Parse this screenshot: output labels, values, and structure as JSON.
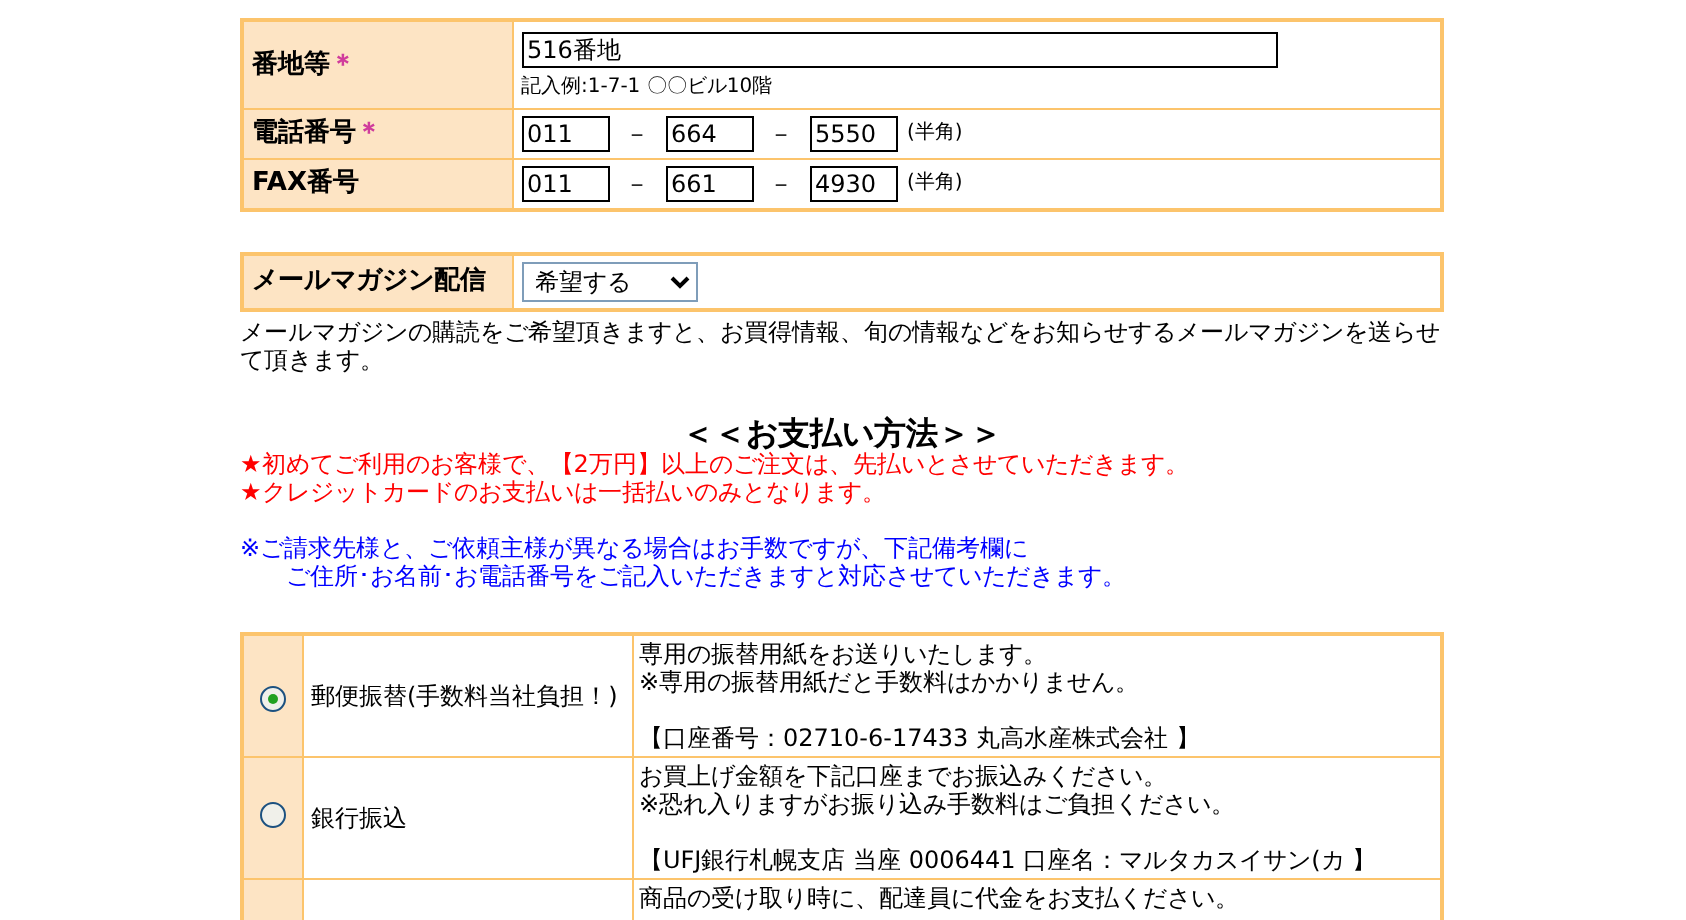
{
  "address_form": {
    "rows": [
      {
        "kind": "single",
        "label": "番地等",
        "required_mark": "＊",
        "value": "516番地",
        "hint": "記入例:1-7-1 〇〇ビル10階"
      },
      {
        "kind": "phone",
        "label": "電話番号",
        "required_mark": "＊",
        "parts": [
          "011",
          "664",
          "5550"
        ],
        "note": "(半角)"
      },
      {
        "kind": "phone",
        "label": "FAX番号",
        "parts": [
          "011",
          "661",
          "4930"
        ],
        "note": "(半角)"
      }
    ],
    "separator": "－"
  },
  "mail_magazine": {
    "label": "メールマガジン配信",
    "value": "希望する",
    "description": "メールマガジンの購読をご希望頂きますと、お買得情報、旬の情報などをお知らせするメールマガジンを送らせて頂きます。"
  },
  "payment": {
    "heading": "＜＜お支払い方法＞＞",
    "notices": [
      {
        "kind": "warning",
        "text": "★初めてご利用のお客様で、【2万円】以上のご注文は、先払いとさせていただきます。"
      },
      {
        "kind": "warning",
        "text": "★クレジットカードのお支払いは一括払いのみとなります。"
      },
      {
        "kind": "info",
        "text": "※ご請求先様と、ご依頼主様が異なる場合はお手数ですが、下記備考欄に"
      },
      {
        "kind": "info_indent",
        "text": "ご住所･お名前･お電話番号をご記入いただきますと対応させていただきます。"
      }
    ],
    "methods": [
      {
        "selected": true,
        "name": "郵便振替(手数料当社負担！)",
        "paragraphs": [
          [
            "専用の振替用紙をお送りいたします。",
            "※専用の振替用紙だと手数料はかかりません。"
          ],
          [
            "【口座番号：02710-6-17433 丸高水産株式会社 】"
          ]
        ]
      },
      {
        "selected": false,
        "name": "銀行振込",
        "paragraphs": [
          [
            "お買上げ金額を下記口座までお振込みください。",
            "※恐れ入りますがお振り込み手数料はご負担ください。"
          ],
          [
            "【UFJ銀行札幌支店 当座 0006441 口座名：マルタカスイサン(カ 】"
          ]
        ]
      },
      {
        "paragraphs": [
          [
            "商品の受け取り時に、配達員に代金をお支払ください。"
          ]
        ]
      }
    ]
  }
}
